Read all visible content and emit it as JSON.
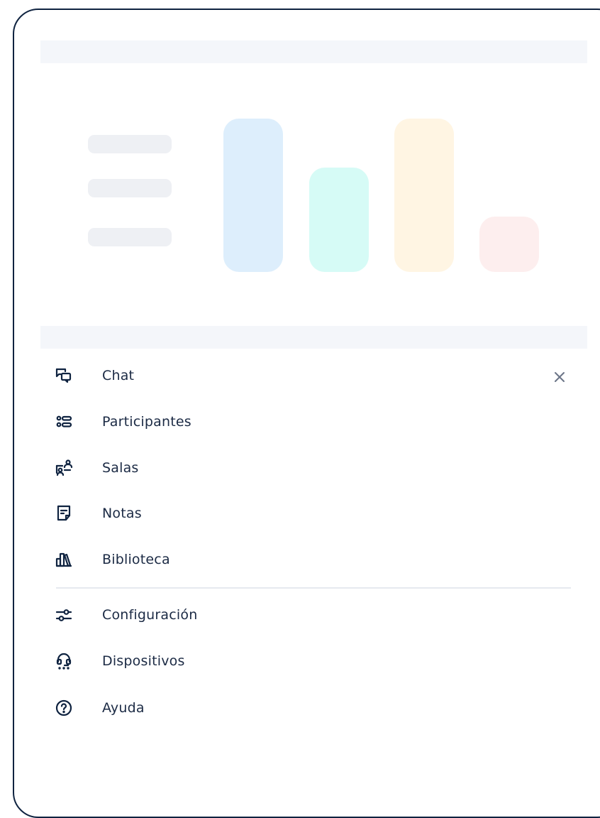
{
  "preview": {
    "bar_colors": [
      "#ddeefc",
      "#d6fbf6",
      "#fff5e3",
      "#fdeeee"
    ],
    "bar_levels": [
      1.0,
      0.68,
      1.0,
      0.36
    ]
  },
  "menu": {
    "items": [
      {
        "label": "Chat",
        "icon": "chat-icon"
      },
      {
        "label": "Participantes",
        "icon": "participants-list-icon"
      },
      {
        "label": "Salas",
        "icon": "breakout-rooms-icon"
      },
      {
        "label": "Notas",
        "icon": "notes-icon"
      },
      {
        "label": "Biblioteca",
        "icon": "library-icon"
      }
    ],
    "secondary_items": [
      {
        "label": "Configuración",
        "icon": "settings-sliders-icon"
      },
      {
        "label": "Dispositivos",
        "icon": "devices-headset-icon"
      },
      {
        "label": "Ayuda",
        "icon": "help-icon"
      }
    ],
    "close_icon": "close-icon"
  },
  "colors": {
    "icon": "#0f2340",
    "text": "#1b2a44",
    "divider": "#e6e9ef"
  }
}
